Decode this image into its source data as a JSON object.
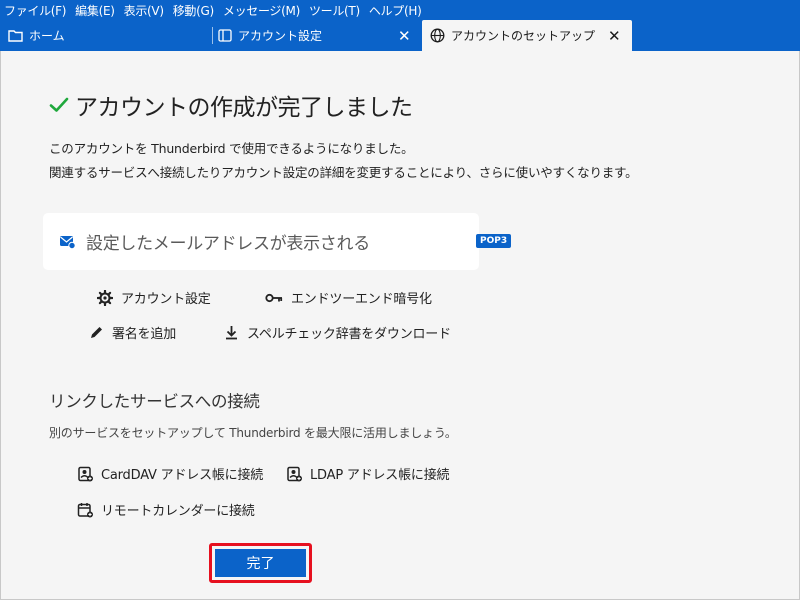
{
  "menu": [
    "ファイル(F)",
    "編集(E)",
    "表示(V)",
    "移動(G)",
    "メッセージ(M)",
    "ツール(T)",
    "ヘルプ(H)"
  ],
  "tabs": [
    {
      "label": "ホーム",
      "icon": "folder-icon"
    },
    {
      "label": "アカウント設定",
      "icon": "panel-icon",
      "close": "✕"
    },
    {
      "label": "アカウントのセットアップ",
      "icon": "globe-icon",
      "close": "✕",
      "active": true
    }
  ],
  "main": {
    "title": "アカウントの作成が完了しました",
    "desc1": "このアカウントを Thunderbird で使用できるようになりました。",
    "desc2": "関連するサービスへ接続したりアカウント設定の詳細を変更することにより、さらに使いやすくなります。",
    "address_placeholder": "設定したメールアドレスが表示される",
    "protocol_badge": "POP3",
    "actions": {
      "account_settings": "アカウント設定",
      "e2e": "エンドツーエンド暗号化",
      "signature": "署名を追加",
      "dictionary": "スペルチェック辞書をダウンロード"
    },
    "linked_title": "リンクしたサービスへの接続",
    "linked_sub": "別のサービスをセットアップして Thunderbird を最大限に活用しましょう。",
    "services": {
      "carddav": "CardDAV アドレス帳に接続",
      "ldap": "LDAP アドレス帳に接続",
      "calendar": "リモートカレンダーに接続"
    },
    "finish_label": "完了"
  },
  "colors": {
    "accent": "#0b63c9",
    "success": "#1fa83c",
    "highlight": "#e6101f"
  }
}
